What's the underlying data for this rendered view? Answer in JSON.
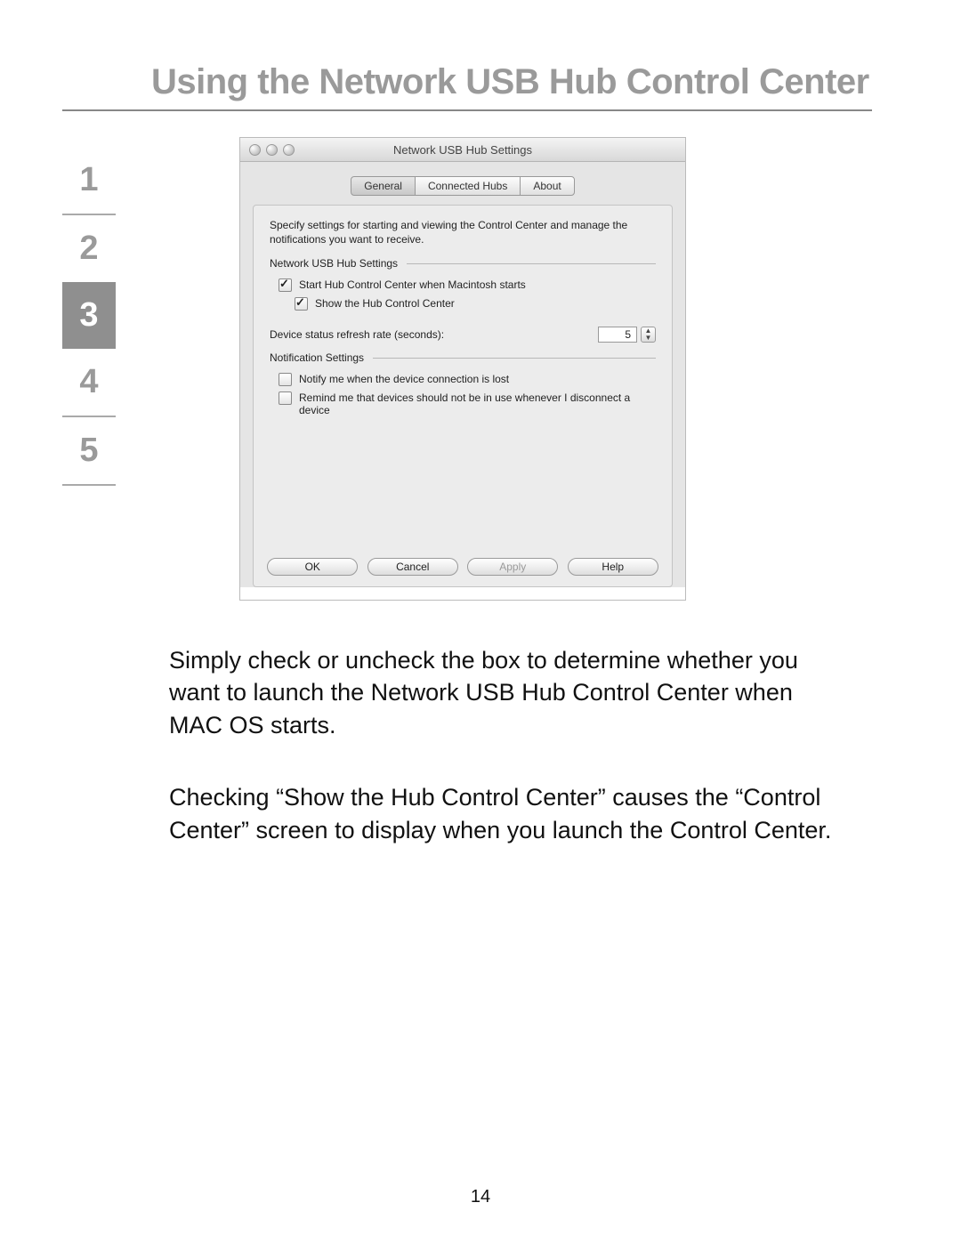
{
  "heading": "Using the Network USB Hub Control Center",
  "sidenav": {
    "items": [
      "1",
      "2",
      "3",
      "4",
      "5"
    ],
    "active_index": 2
  },
  "window": {
    "title": "Network USB Hub Settings",
    "tabs": {
      "general": "General",
      "connected_hubs": "Connected Hubs",
      "about": "About",
      "active": "general"
    },
    "intro": "Specify settings for starting and viewing the Control Center and manage the notifications you want to receive.",
    "group1_label": "Network USB Hub Settings",
    "chk_start": {
      "label": "Start Hub Control Center when Macintosh starts",
      "checked": true
    },
    "chk_show": {
      "label": "Show the Hub Control Center",
      "checked": true
    },
    "refresh_label": "Device status refresh rate (seconds):",
    "refresh_value": "5",
    "group2_label": "Notification Settings",
    "chk_notify_lost": {
      "label": "Notify me when the device connection is lost",
      "checked": false
    },
    "chk_remind": {
      "label": "Remind me that devices should not be in use whenever I disconnect a device",
      "checked": false
    },
    "buttons": {
      "ok": "OK",
      "cancel": "Cancel",
      "apply": "Apply",
      "help": "Help"
    }
  },
  "body_text": {
    "p1": "Simply check or uncheck the box to determine whether you want to launch the Network USB Hub Control Center when MAC OS starts.",
    "p2": "Checking “Show the Hub Control Center” causes the “Control Center” screen to display when you launch the Control Center."
  },
  "page_number": "14"
}
